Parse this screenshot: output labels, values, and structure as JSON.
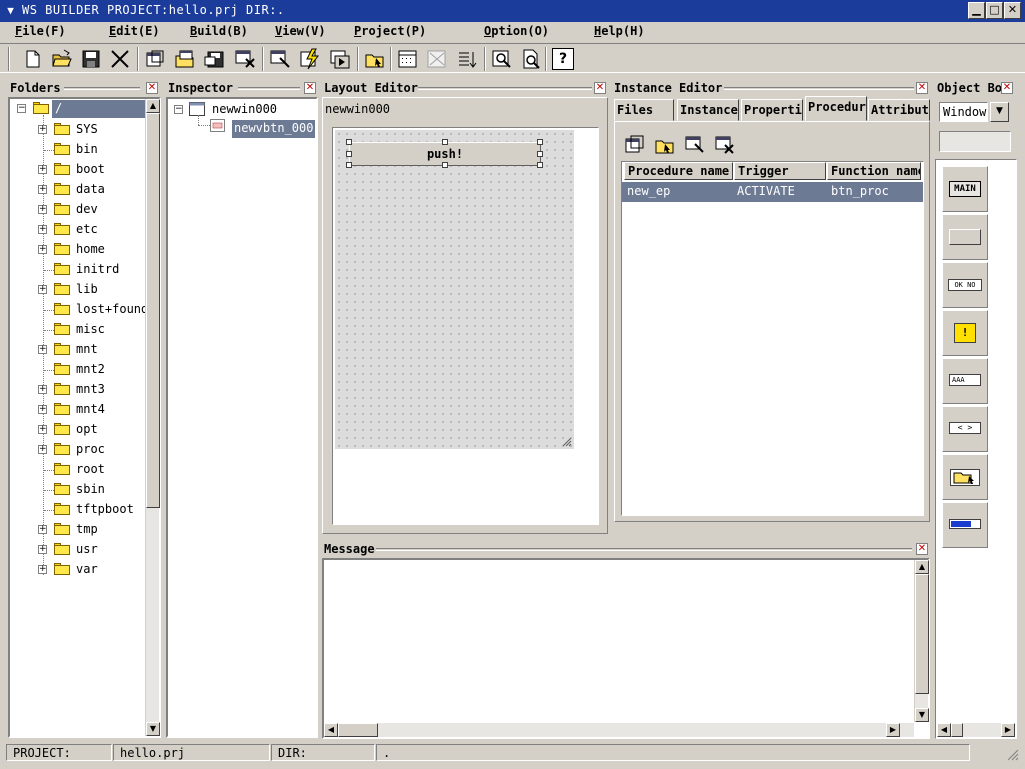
{
  "window": {
    "title": "WS BUILDER PROJECT:hello.prj DIR:.",
    "min_glyph": "▁",
    "max_glyph": "□",
    "close_glyph": "✕"
  },
  "menu": [
    {
      "label": "File(F)"
    },
    {
      "label": "Edit(E)"
    },
    {
      "label": "Build(B)"
    },
    {
      "label": "View(V)"
    },
    {
      "label": "Project(P)"
    },
    {
      "label": "Option(O)"
    },
    {
      "label": "Help(H)"
    }
  ],
  "toolbar": {
    "icons": [
      "new-file-icon",
      "open-folder-icon",
      "save-icon",
      "cut-icon",
      "new-window-icon",
      "open-window-icon",
      "save-window-icon",
      "delete-window-icon",
      "edit-window-icon",
      "build-icon",
      "run-icon",
      "folder-arrow-icon",
      "grid-icon",
      "grid-off-icon",
      "align-icon",
      "find-icon",
      "preview-icon",
      "help-icon"
    ],
    "help_glyph": "?"
  },
  "folders": {
    "title": "Folders",
    "root": "/",
    "items": [
      {
        "name": "SYS",
        "expand": true
      },
      {
        "name": "bin",
        "expand": false
      },
      {
        "name": "boot",
        "expand": true
      },
      {
        "name": "data",
        "expand": true
      },
      {
        "name": "dev",
        "expand": true
      },
      {
        "name": "etc",
        "expand": true
      },
      {
        "name": "home",
        "expand": true
      },
      {
        "name": "initrd",
        "expand": false
      },
      {
        "name": "lib",
        "expand": true
      },
      {
        "name": "lost+found",
        "expand": false
      },
      {
        "name": "misc",
        "expand": false
      },
      {
        "name": "mnt",
        "expand": true
      },
      {
        "name": "mnt2",
        "expand": false
      },
      {
        "name": "mnt3",
        "expand": true
      },
      {
        "name": "mnt4",
        "expand": true
      },
      {
        "name": "opt",
        "expand": true
      },
      {
        "name": "proc",
        "expand": true
      },
      {
        "name": "root",
        "expand": false
      },
      {
        "name": "sbin",
        "expand": false
      },
      {
        "name": "tftpboot",
        "expand": false
      },
      {
        "name": "tmp",
        "expand": true
      },
      {
        "name": "usr",
        "expand": true
      },
      {
        "name": "var",
        "expand": true
      }
    ]
  },
  "inspector": {
    "title": "Inspector",
    "window_node": "newwin000",
    "button_node": "newvbtn_000"
  },
  "layout_editor": {
    "title": "Layout Editor",
    "window_name": "newwin000",
    "button_label": "push!"
  },
  "instance_editor": {
    "title": "Instance Editor",
    "tabs": [
      "Files",
      "Instance",
      "Properti",
      "Procedur",
      "Attribut"
    ],
    "active_tab": 3,
    "columns": [
      "Procedure name",
      "Trigger",
      "Function name"
    ],
    "rows": [
      {
        "procedure": "new_ep",
        "trigger": "ACTIVATE",
        "function": "btn_proc"
      }
    ]
  },
  "object_box": {
    "title": "Object Bo",
    "selected": "Window",
    "items": [
      {
        "icon": "main-window-icon",
        "label": "MAIN"
      },
      {
        "icon": "button-widget-icon",
        "label": ""
      },
      {
        "icon": "dialog-buttons-icon",
        "label": "OK NO"
      },
      {
        "icon": "warning-icon",
        "label": "!"
      },
      {
        "icon": "text-field-icon",
        "label": "AAA"
      },
      {
        "icon": "spin-arrows-icon",
        "label": "< >"
      },
      {
        "icon": "file-select-icon",
        "label": ""
      },
      {
        "icon": "progress-bar-icon",
        "label": ""
      }
    ]
  },
  "message": {
    "title": "Message"
  },
  "statusbar": {
    "project_label": "PROJECT:",
    "project_value": "hello.prj",
    "dir_label": "DIR:",
    "dir_value": "."
  },
  "colors": {
    "titlebar": "#1c3c9c",
    "selection": "#6d7a94",
    "panel": "#d4d0c8"
  }
}
